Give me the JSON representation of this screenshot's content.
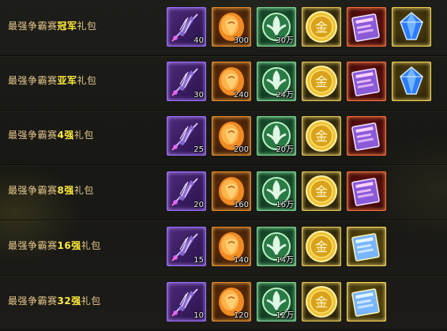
{
  "rows": [
    {
      "title_prefix": "最强争霸赛",
      "title_highlight": "冠军",
      "title_suffix": "礼包",
      "items": [
        {
          "icon": "feather-weapon-icon",
          "count": "40"
        },
        {
          "icon": "orange-shell-icon",
          "count": "300"
        },
        {
          "icon": "green-leaf-emblem-icon",
          "count": "30万"
        },
        {
          "icon": "gold-coin-icon",
          "count": ""
        },
        {
          "icon": "skill-book-icon",
          "count": ""
        },
        {
          "icon": "blue-gem-icon",
          "count": ""
        }
      ]
    },
    {
      "title_prefix": "最强争霸赛",
      "title_highlight": "亚军",
      "title_suffix": "礼包",
      "items": [
        {
          "icon": "feather-weapon-icon",
          "count": "30"
        },
        {
          "icon": "orange-shell-icon",
          "count": "240"
        },
        {
          "icon": "green-leaf-emblem-icon",
          "count": "24万"
        },
        {
          "icon": "gold-coin-icon",
          "count": ""
        },
        {
          "icon": "skill-book-icon",
          "count": ""
        },
        {
          "icon": "blue-gem-icon",
          "count": ""
        }
      ]
    },
    {
      "title_prefix": "最强争霸赛",
      "title_highlight": "4强",
      "title_suffix": "礼包",
      "items": [
        {
          "icon": "feather-weapon-icon",
          "count": "25"
        },
        {
          "icon": "orange-shell-icon",
          "count": "200"
        },
        {
          "icon": "green-leaf-emblem-icon",
          "count": "20万"
        },
        {
          "icon": "gold-coin-icon",
          "count": ""
        },
        {
          "icon": "skill-book-icon",
          "count": ""
        }
      ]
    },
    {
      "title_prefix": "最强争霸赛",
      "title_highlight": "8强",
      "title_suffix": "礼包",
      "items": [
        {
          "icon": "feather-weapon-icon",
          "count": "20"
        },
        {
          "icon": "orange-shell-icon",
          "count": "160"
        },
        {
          "icon": "green-leaf-emblem-icon",
          "count": "16万"
        },
        {
          "icon": "gold-coin-icon",
          "count": ""
        },
        {
          "icon": "skill-book-icon",
          "count": ""
        }
      ]
    },
    {
      "title_prefix": "最强争霸赛",
      "title_highlight": "16强",
      "title_suffix": "礼包",
      "items": [
        {
          "icon": "feather-weapon-icon",
          "count": "15"
        },
        {
          "icon": "orange-shell-icon",
          "count": "140"
        },
        {
          "icon": "green-leaf-emblem-icon",
          "count": "14万"
        },
        {
          "icon": "gold-coin-icon",
          "count": ""
        },
        {
          "icon": "gold-skill-book-icon",
          "count": ""
        }
      ]
    },
    {
      "title_prefix": "最强争霸赛",
      "title_highlight": "32强",
      "title_suffix": "礼包",
      "items": [
        {
          "icon": "feather-weapon-icon",
          "count": "10"
        },
        {
          "icon": "orange-shell-icon",
          "count": "120"
        },
        {
          "icon": "green-leaf-emblem-icon",
          "count": "12万"
        },
        {
          "icon": "gold-coin-icon",
          "count": ""
        },
        {
          "icon": "gold-skill-book-icon",
          "count": ""
        }
      ]
    }
  ],
  "colors": {
    "title": "#e6c98b",
    "highlight": "#ffeb3b"
  }
}
